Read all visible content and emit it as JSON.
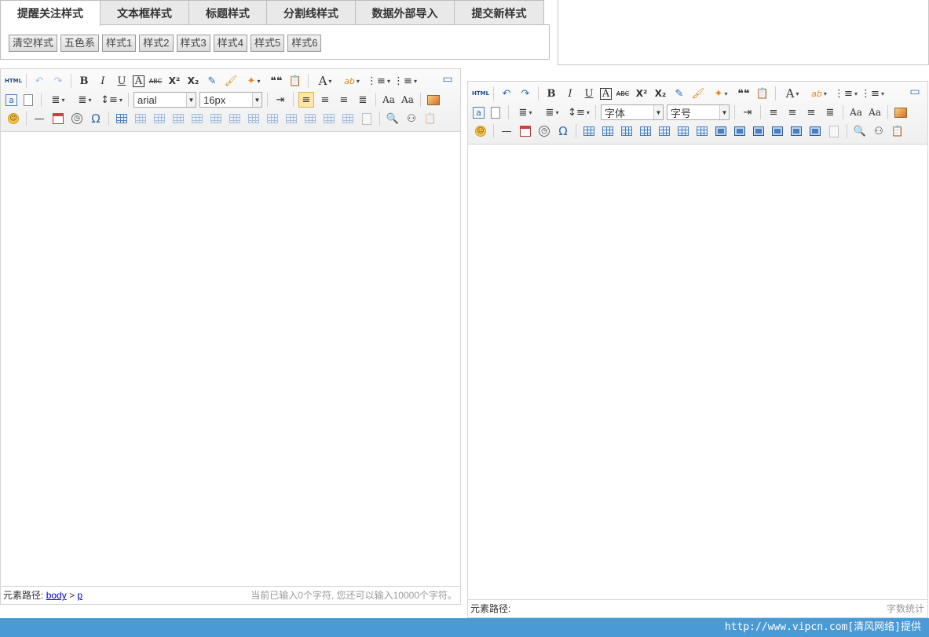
{
  "tabs": [
    {
      "label": "提醒关注样式",
      "active": true
    },
    {
      "label": "文本框样式",
      "active": false
    },
    {
      "label": "标题样式",
      "active": false
    },
    {
      "label": "分割线样式",
      "active": false
    },
    {
      "label": "数据外部导入",
      "active": false
    },
    {
      "label": "提交新样式",
      "active": false
    }
  ],
  "style_buttons": [
    "清空样式",
    "五色系",
    "样式1",
    "样式2",
    "样式3",
    "样式4",
    "样式5",
    "样式6"
  ],
  "icons": {
    "html": "HTML",
    "undo": "↶",
    "redo": "↷",
    "bold": "B",
    "italic": "I",
    "underline": "U",
    "fontborder": "A",
    "strike": "ABC",
    "superscript": "X²",
    "subscript": "X₂",
    "eraser": "✎",
    "brush": "🖌",
    "wand": "✦",
    "quote": "❝❝",
    "paste": "📋",
    "forecolor": "A",
    "backcolor": "ab",
    "ordered_list": "⋮≡",
    "unordered_list": "⋮≡",
    "anchor": "a",
    "page": "",
    "indent_left": "≣",
    "indent_right": "≡",
    "align_left": "≡",
    "align_center": "≡",
    "align_right": "≡",
    "justify": "≡",
    "case_up": "Aa",
    "case_down": "Aa",
    "emotion": "☺",
    "hr": "—",
    "date": "",
    "time": "◷",
    "special_char": "Ω",
    "search": "🔍",
    "binoculars": "⚇",
    "paste_plain": "📋"
  },
  "editor_left": {
    "font_family": "arial",
    "font_size": "16px",
    "status_path_label": "元素路径:",
    "path_body": "body",
    "path_sep": ">",
    "path_p": "p",
    "word_count": "当前已输入0个字符, 您还可以输入10000个字符。"
  },
  "editor_right": {
    "font_family": "字体",
    "font_size": "字号",
    "status_path_label": "元素路径:",
    "word_count": "字数统计"
  },
  "footer": {
    "text": "http://www.vipcn.com[清风网络]提供"
  }
}
